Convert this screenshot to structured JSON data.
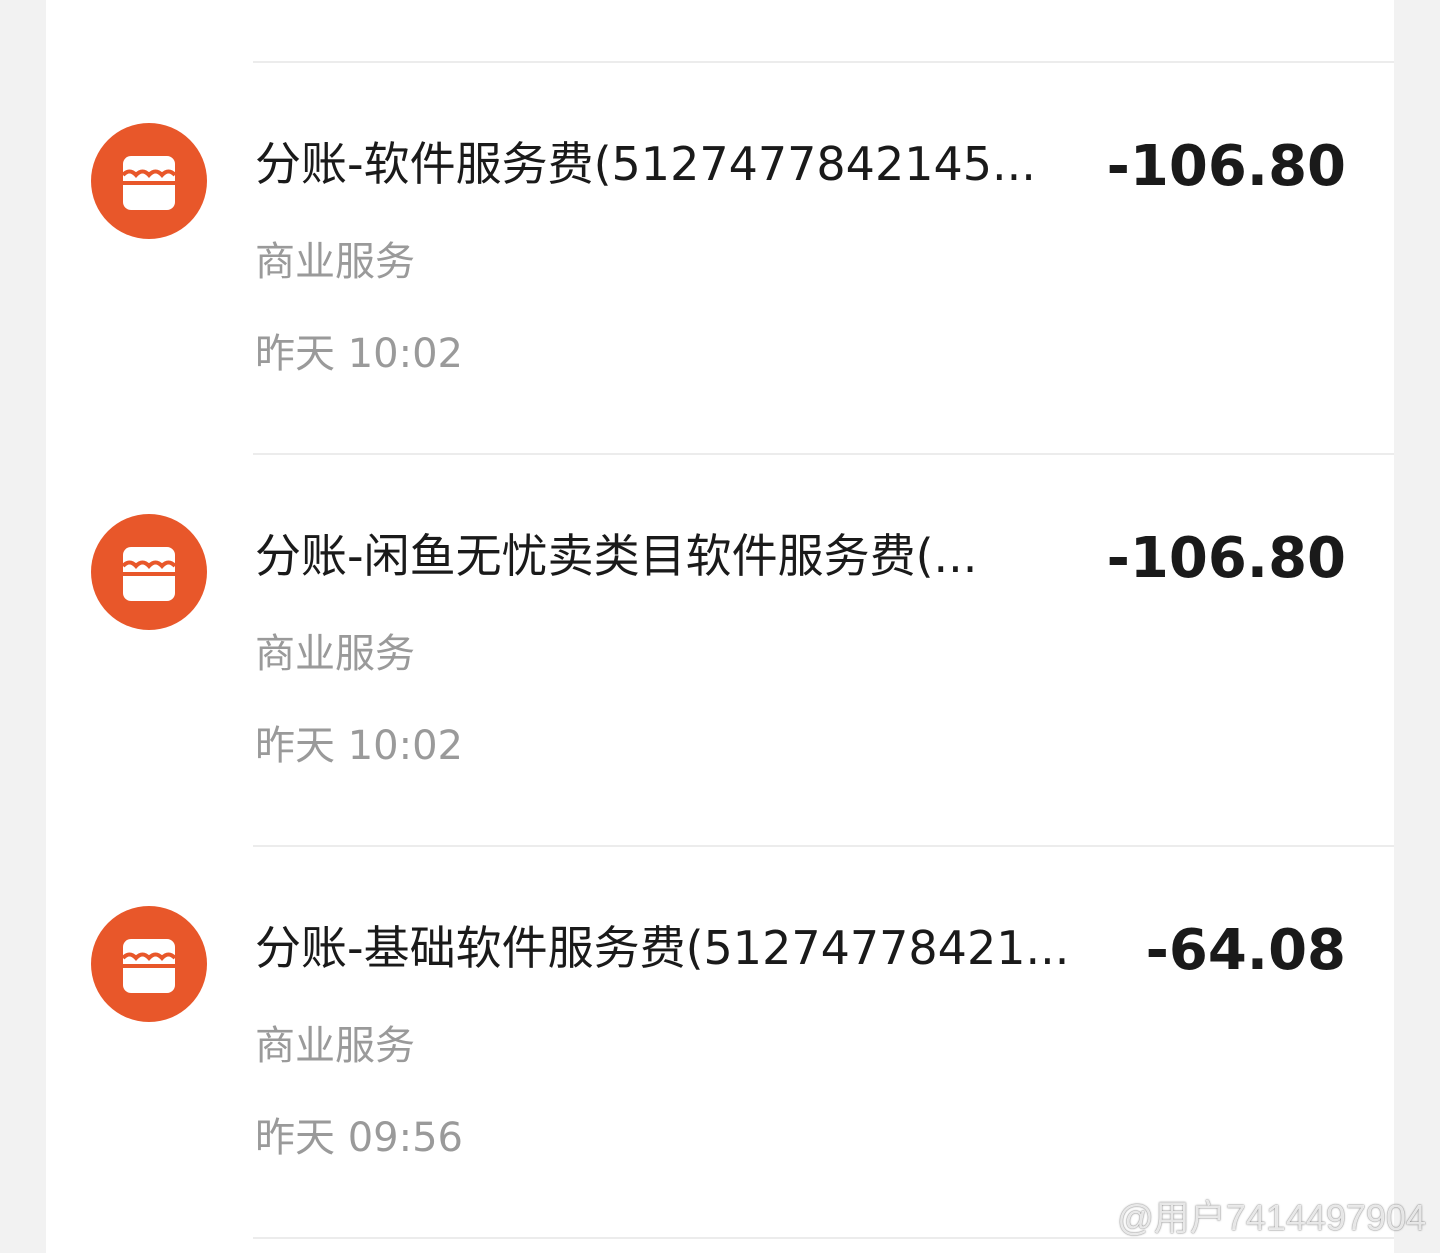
{
  "brand_color": "#e8572a",
  "transactions": [
    {
      "icon": "store-icon",
      "title": "分账-软件服务费(5127477842145...",
      "amount": "-106.80",
      "category": "商业服务",
      "time": "昨天 10:02"
    },
    {
      "icon": "store-icon",
      "title": "分账-闲鱼无忧卖类目软件服务费(...",
      "amount": "-106.80",
      "category": "商业服务",
      "time": "昨天 10:02"
    },
    {
      "icon": "store-icon",
      "title": "分账-基础软件服务费(51274778421...",
      "amount": "-64.08",
      "category": "商业服务",
      "time": "昨天 09:56"
    }
  ],
  "watermark": {
    "text": "@用户7414497904",
    "icon": "weibo-logo"
  }
}
